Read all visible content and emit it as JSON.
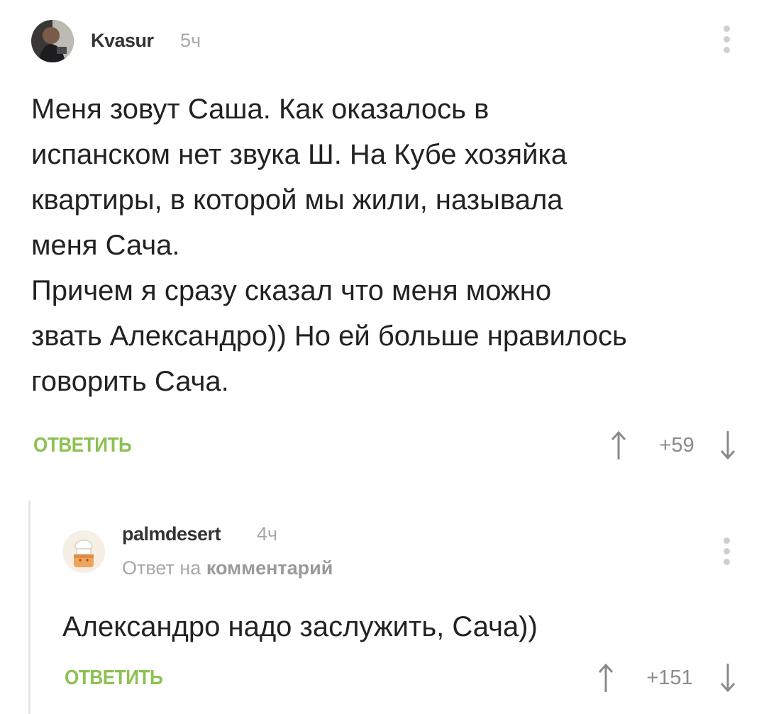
{
  "comments": [
    {
      "username": "Kvasur",
      "time": "5ч",
      "text": "Меня зовут Саша. Как оказалось в\nиспанском нет звука Ш. На Кубе хозяйка\nквартиры, в которой мы жили,  называла\nменя Сача.\nПричем я сразу сказал что меня можно\nзвать Александро)) Но ей больше нравилось\nговорить Сача.",
      "reply_label": "ОТВЕТИТЬ",
      "score": "+59"
    },
    {
      "username": "palmdesert",
      "time": "4ч",
      "reply_to_prefix": "Ответ на",
      "reply_to_link": "комментарий",
      "text": "Александро надо заслужить, Сача))",
      "reply_label": "ОТВЕТИТЬ",
      "score": "+151"
    }
  ],
  "colors": {
    "accent_green": "#8dc152",
    "muted_gray": "#a8a8a8",
    "text": "#222222"
  },
  "icons": {
    "menu": "vertical-dots-icon",
    "upvote": "arrow-up-icon",
    "downvote": "arrow-down-icon"
  }
}
